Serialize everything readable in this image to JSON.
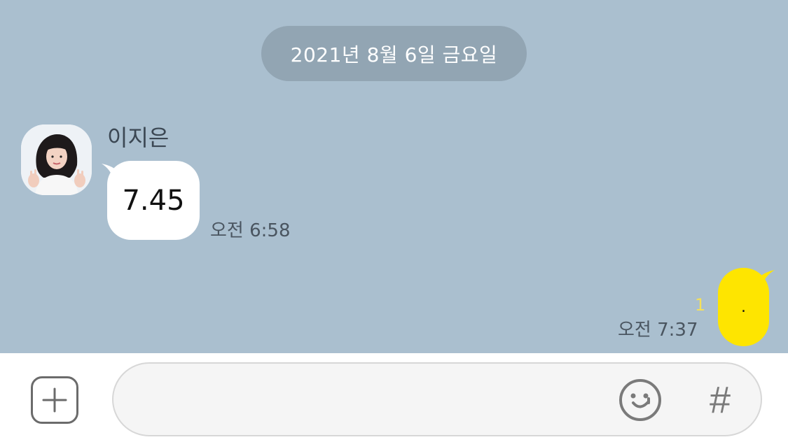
{
  "chat": {
    "date_divider": "2021년 8월 6일 금요일",
    "incoming": {
      "sender_name": "이지은",
      "message": "7.45",
      "time": "오전 6:58",
      "avatar_icon": "profile-photo"
    },
    "outgoing": {
      "message": ".",
      "unread_count": "1",
      "time": "오전 7:37"
    }
  },
  "input_bar": {
    "plus_icon": "plus-square-icon",
    "text_value": "",
    "emoji_icon": "smiley-icon",
    "hash_label": "#"
  },
  "colors": {
    "chat_background": "#aabfcf",
    "date_pill": "#92a5b3",
    "incoming_bubble": "#ffffff",
    "outgoing_bubble": "#fee500",
    "unread_count": "#f5e05a"
  }
}
